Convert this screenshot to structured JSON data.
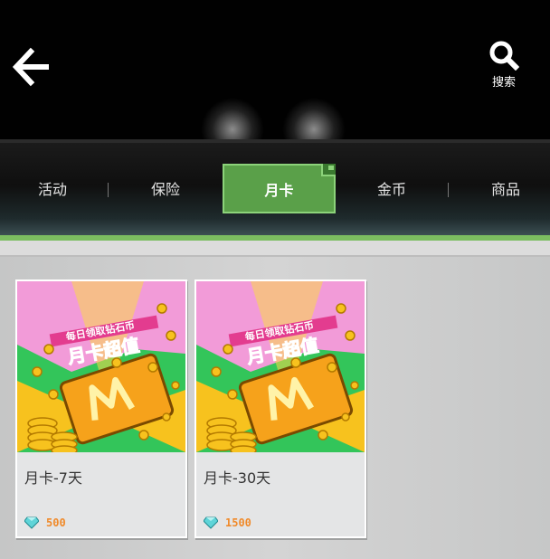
{
  "header": {
    "search_label": "搜索"
  },
  "tabs": [
    {
      "label": "活动",
      "active": false
    },
    {
      "label": "保险",
      "active": false
    },
    {
      "label": "月卡",
      "active": true
    },
    {
      "label": "金币",
      "active": false
    },
    {
      "label": "商品",
      "active": false
    }
  ],
  "products": [
    {
      "name": "月卡-7天",
      "price": "500",
      "currency_icon": "diamond-icon",
      "banner": {
        "line1": "每日领取钻石币",
        "line2": "月卡超值"
      }
    },
    {
      "name": "月卡-30天",
      "price": "1500",
      "currency_icon": "diamond-icon",
      "banner": {
        "line1": "每日领取钻石币",
        "line2": "月卡超值"
      }
    }
  ],
  "colors": {
    "accent_green": "#5aa049",
    "price_orange": "#f08a2a",
    "banner_pink": "#f29bd8",
    "banner_green": "#33c55a",
    "coin_yellow": "#f7c21e"
  }
}
